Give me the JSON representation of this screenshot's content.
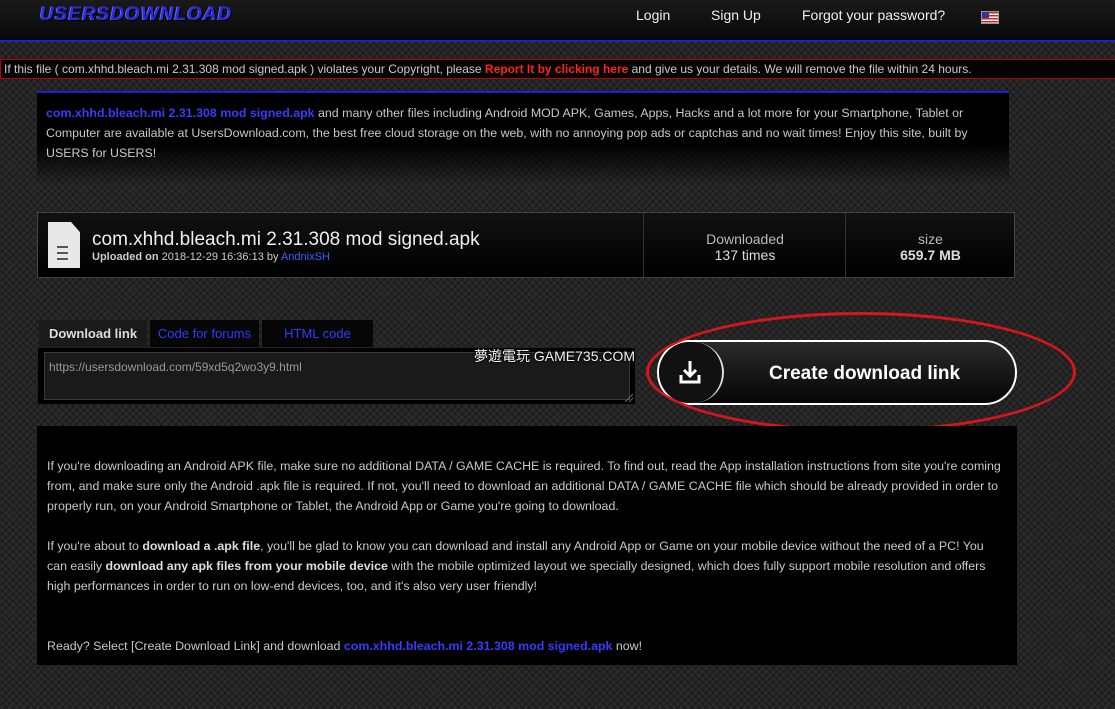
{
  "header": {
    "logo": "USERSDOWNLOAD",
    "nav": {
      "login": "Login",
      "signup": "Sign Up",
      "forgot": "Forgot your password?"
    },
    "language_flag": "us-flag-icon"
  },
  "notice": {
    "before": "If this file ( com.xhhd.bleach.mi 2.31.308 mod signed.apk ) violates your Copyright, please ",
    "report_link": "Report It by clicking here",
    "after": " and give us your details. We will remove the file within 24 hours."
  },
  "intro": {
    "filename": "com.xhhd.bleach.mi 2.31.308 mod signed.apk",
    "text": " and many other files including Android MOD APK, Games, Apps, Hacks and a lot more for your Smartphone, Tablet or Computer are available at UsersDownload.com, the best free cloud storage on the web, with no annoying pop ads or captchas and no wait times! Enjoy this site, built by USERS for USERS!"
  },
  "file": {
    "icon": "document-icon",
    "name": "com.xhhd.bleach.mi 2.31.308 mod signed.apk",
    "uploaded_label": "Uploaded on",
    "uploaded_date": " 2018-12-29 16:36:13 by ",
    "uploader": "AndnixSH",
    "downloaded_label": "Downloaded",
    "downloaded_value": "137 times",
    "size_label": "size",
    "size_value": "659.7 MB"
  },
  "tabs": [
    {
      "label": "Download link",
      "active": true
    },
    {
      "label": "Code for forums",
      "active": false
    },
    {
      "label": "HTML code",
      "active": false
    }
  ],
  "link_field": {
    "value": "https://usersdownload.com/59xd5q2wo3y9.html"
  },
  "watermark": "夢遊電玩 GAME735.COM",
  "create_button": {
    "label": "Create download link",
    "icon": "download-tray-icon"
  },
  "info": {
    "p1": "If you're downloading an Android APK file, make sure no additional DATA / GAME CACHE is required. To find out, read the App installation instructions from site you're coming from, and make sure only the Android .apk file is required. If not, you'll need to download an additional DATA / GAME CACHE file which should be already provided in order to properly run, on your Android Smartphone or Tablet, the Android App or Game you're going to download.",
    "p2_a": "If you're about to ",
    "p2_b": "download a .apk file",
    "p2_c": ", you'll be glad to know you can download and install any Android App or Game on your mobile device without the need of a PC! You can easily ",
    "p2_d": "download any apk files from your mobile device",
    "p2_e": " with the mobile optimized layout we specially designed, which does fully support mobile resolution and offers high performances in order to run on low-end devices, too, and it's also very user friendly!",
    "p3_a": "Ready? Select [Create Download Link] and download ",
    "p3_file": "com.xhhd.bleach.mi 2.31.308 mod signed.apk",
    "p3_b": " now!"
  },
  "colors": {
    "accent_blue": "#1e1ed8",
    "report_red": "#ff2020",
    "annotation_red": "#d8141c"
  }
}
